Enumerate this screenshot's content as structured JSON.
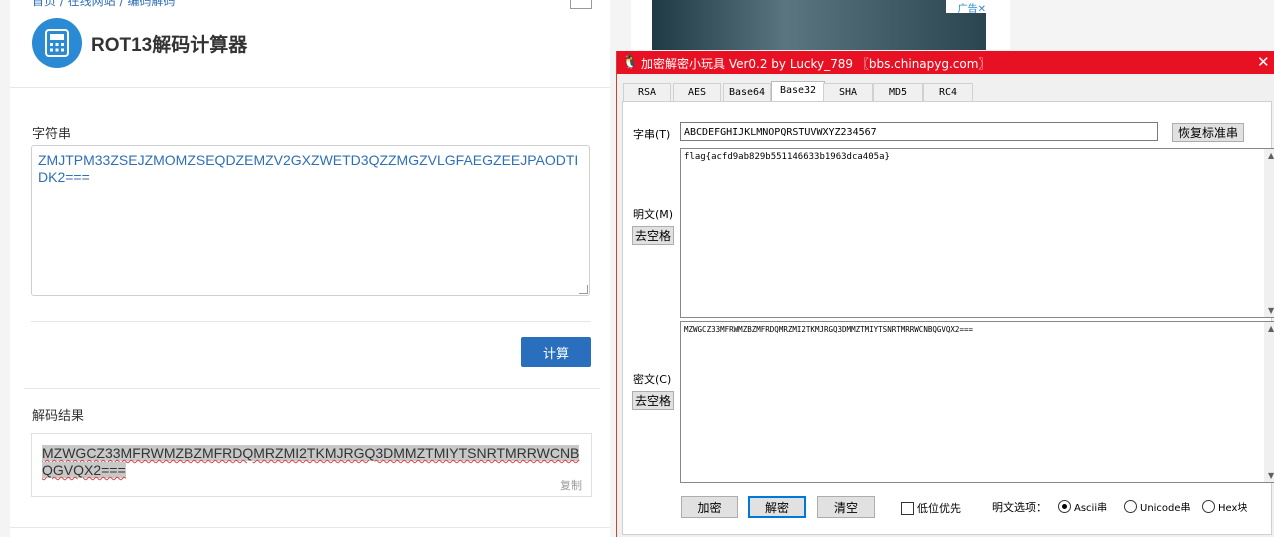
{
  "web": {
    "breadcrumb": "首页 / 在线网站 / 编码解码",
    "title": "ROT13解码计算器",
    "string_label": "字符串",
    "input_value": "ZMJTPM33ZSEJZMOMZSEQDZEMZV2GXZWETD3QZZMGZVLGFAEGZEEJPAODTIDK2===",
    "calc_button": "计算",
    "result_label": "解码结果",
    "result_value": "MZWGCZ33MFRWMZBZMFRDQMRZMI2TKMJRGQ3DMMZTMIYTSNRTMRRWCNBQGVQX2===",
    "copy_label": "复制"
  },
  "ad": {
    "label": "广告",
    "close": "✕"
  },
  "dialog": {
    "title": "加密解密小玩具 Ver0.2 by Lucky_789 〖bbs.chinapyg.com〗",
    "close_icon": "✕",
    "tabs": [
      "RSA",
      "AES",
      "Base64",
      "Base32",
      "SHA",
      "MD5",
      "RC4"
    ],
    "active_tab": "Base32",
    "key_label": "字串(T)",
    "key_value": "ABCDEFGHIJKLMNOPQRSTUVWXYZ234567",
    "restore_button": "恢复标准串",
    "plain_label": "明文(M)",
    "plain_strip_button": "去空格",
    "plain_value": "flag{acfd9ab829b551146633b1963dca405a}",
    "cipher_label": "密文(C)",
    "cipher_strip_button": "去空格",
    "cipher_value": "MZWGCZ33MFRWMZBZMFRDQMRZMI2TKMJRGQ3DMMZTMIYTSNRTMRRWCNBQGVQX2===",
    "encrypt_button": "加密",
    "decrypt_button": "解密",
    "clear_button": "清空",
    "low_bit_label": "低位优先",
    "plain_option_label": "明文选项：",
    "options": [
      "Ascii串",
      "Unicode串",
      "Hex块"
    ],
    "selected_option": "Ascii串"
  }
}
